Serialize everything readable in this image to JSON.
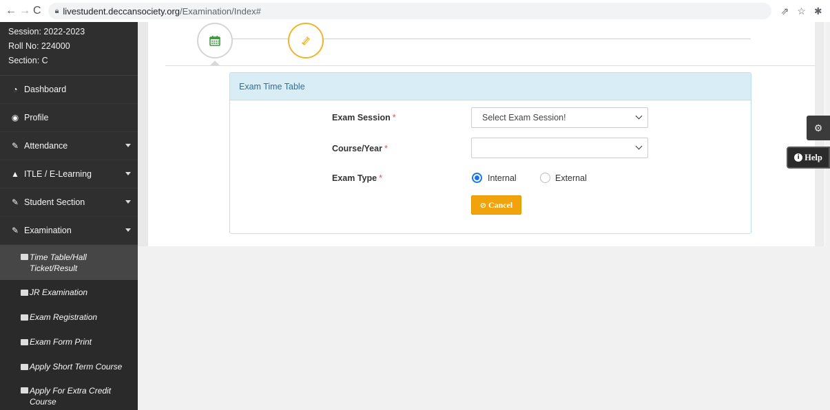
{
  "browser": {
    "back": "←",
    "forward": "→",
    "reload": "C",
    "url_host": "livestudent.deccansociety.org",
    "url_path": "/Examination/Index#",
    "actions": [
      "⇗",
      "☆",
      "✱",
      "▢",
      "●"
    ]
  },
  "sidebar": {
    "session": "Session: 2022-2023",
    "roll_no": "Roll No: 224000",
    "section": "Section: C",
    "items": [
      {
        "label": "Dashboard",
        "icon": "tachometer-icon",
        "glyph": "◔"
      },
      {
        "label": "Profile",
        "icon": "user-circle-icon",
        "glyph": "◉"
      },
      {
        "label": "Attendance",
        "icon": "pencil-icon",
        "glyph": "✎"
      },
      {
        "label": "ITLE / E-Learning",
        "icon": "graduation-cap-icon",
        "glyph": "▲"
      },
      {
        "label": "Student Section",
        "icon": "pencil-icon",
        "glyph": "✎"
      },
      {
        "label": "Examination",
        "icon": "pencil-icon",
        "glyph": "✎"
      }
    ],
    "sub_items": [
      {
        "label": "Time Table/Hall Ticket/Result"
      },
      {
        "label": "JR Examination"
      },
      {
        "label": "Exam Registration"
      },
      {
        "label": "Exam Form Print"
      },
      {
        "label": "Apply Short Term Course"
      },
      {
        "label": "Apply For Extra Credit Course"
      }
    ]
  },
  "panel": {
    "title": "Exam Time Table",
    "exam_session_label": "Exam Session",
    "exam_session_value": "Select Exam Session!",
    "course_year_label": "Course/Year",
    "course_year_value": "",
    "exam_type_label": "Exam Type",
    "required_mark": "*",
    "exam_type_options": [
      "Internal",
      "External"
    ],
    "exam_type_selected": "Internal",
    "cancel_label": "Cancel"
  },
  "floating": {
    "help_label": "Help"
  },
  "colors": {
    "sidebar_bg": "#2f2f2f",
    "panel_heading_bg": "#d9edf7",
    "accent_orange": "#f0a30a",
    "step_active": "#f0b429",
    "step_icon_green": "#3c9a3c"
  }
}
